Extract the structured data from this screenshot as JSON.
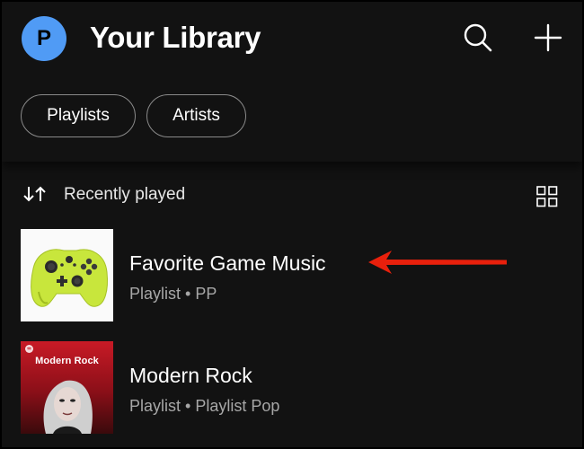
{
  "header": {
    "avatar_initial": "P",
    "title": "Your Library",
    "search_icon": "search-icon",
    "add_icon": "plus-icon"
  },
  "filters": {
    "chips": [
      {
        "label": "Playlists"
      },
      {
        "label": "Artists"
      }
    ]
  },
  "sort": {
    "icon": "sort-arrows-icon",
    "label": "Recently played",
    "view_toggle_icon": "grid-view-icon"
  },
  "library_items": [
    {
      "title": "Favorite Game Music",
      "subtitle": "Playlist • PP",
      "cover": "game-controller-artwork"
    },
    {
      "title": "Modern Rock",
      "subtitle": "Playlist • Playlist Pop",
      "cover": "modern-rock-artwork",
      "cover_text": "Modern Rock"
    }
  ],
  "annotation": {
    "arrow_color": "#e8200c",
    "points_to": "Favorite Game Music"
  },
  "colors": {
    "background": "#121212",
    "avatar": "#509bf5",
    "secondary_text": "#a7a7a7",
    "chip_border": "#8a8a8a"
  }
}
